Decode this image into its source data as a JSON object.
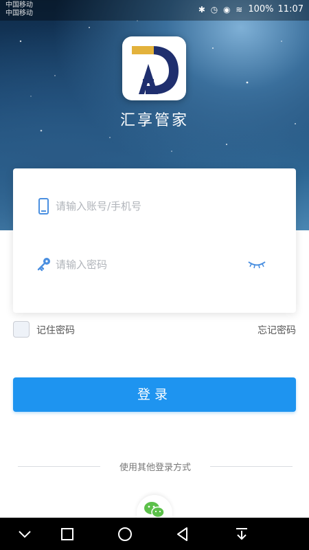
{
  "status_bar": {
    "carrier_line1": "中国移动",
    "carrier_line2": "中国移动",
    "icons": "✱ ◷ ◉ ≋",
    "battery": "100%",
    "time": "11:07"
  },
  "app": {
    "name": "汇享管家",
    "logo_icon": "da-logo-icon"
  },
  "form": {
    "account_placeholder": "请输入账号/手机号",
    "account_icon": "phone-icon",
    "password_placeholder": "请输入密码",
    "password_icon": "key-icon",
    "toggle_icon": "eye-closed-icon"
  },
  "options": {
    "remember_label": "记住密码",
    "forgot_label": "忘记密码"
  },
  "login_button": "登录",
  "other_login": {
    "label": "使用其他登录方式",
    "wechat_icon": "wechat-icon"
  },
  "nav_bar": {
    "icons": [
      "chevron-down-icon",
      "recent-apps-icon",
      "home-icon",
      "back-icon",
      "notification-pull-icon"
    ]
  },
  "colors": {
    "primary": "#1e94f0",
    "icon_blue": "#4a8fe0",
    "logo_navy": "#1f2f6e",
    "logo_gold": "#e3b23c"
  }
}
